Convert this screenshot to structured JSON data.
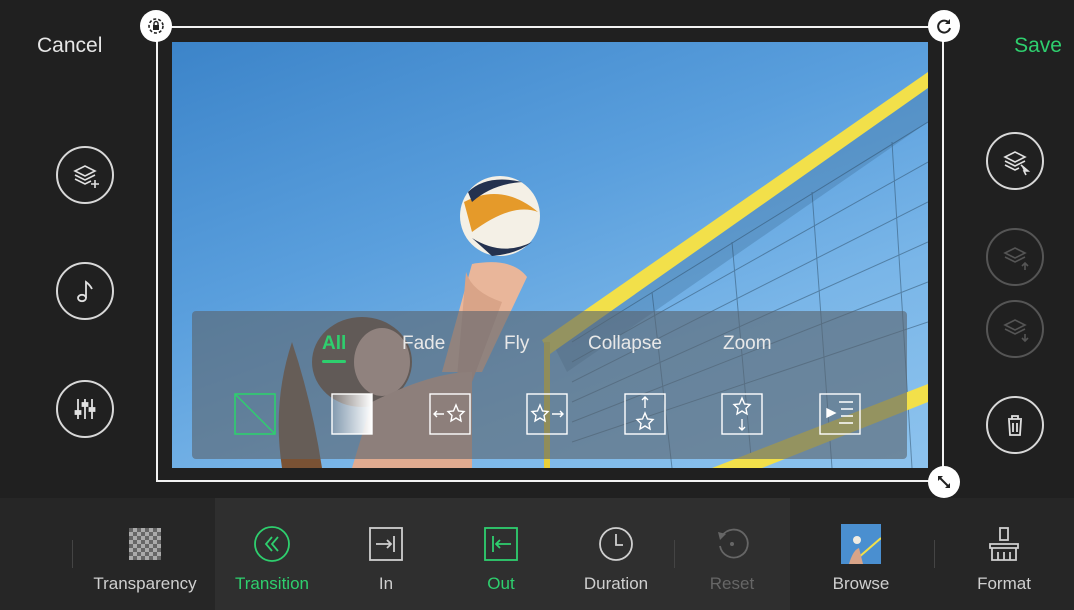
{
  "header": {
    "cancel_label": "Cancel",
    "save_label": "Save"
  },
  "colors": {
    "accent": "#2ecf6e",
    "background": "#202020",
    "panel": "#5a646e"
  },
  "panel": {
    "tabs": [
      {
        "label": "All",
        "active": true
      },
      {
        "label": "Fade",
        "active": false
      },
      {
        "label": "Fly",
        "active": false
      },
      {
        "label": "Collapse",
        "active": false
      },
      {
        "label": "Zoom",
        "active": false
      }
    ],
    "effects": [
      "none-icon",
      "fade-icon",
      "fly-left-icon",
      "fly-right-icon",
      "fly-up-icon",
      "fly-down-icon",
      "collapse-icon"
    ]
  },
  "left_tools": [
    "add-layer-icon",
    "music-note-icon",
    "equalizer-icon"
  ],
  "right_tools": [
    "select-layer-icon",
    "layer-up-icon",
    "layer-down-icon",
    "trash-icon"
  ],
  "toolbar": {
    "transparency": "Transparency",
    "transition": "Transition",
    "in": "In",
    "out": "Out",
    "duration": "Duration",
    "reset": "Reset",
    "browse": "Browse",
    "format": "Format"
  }
}
